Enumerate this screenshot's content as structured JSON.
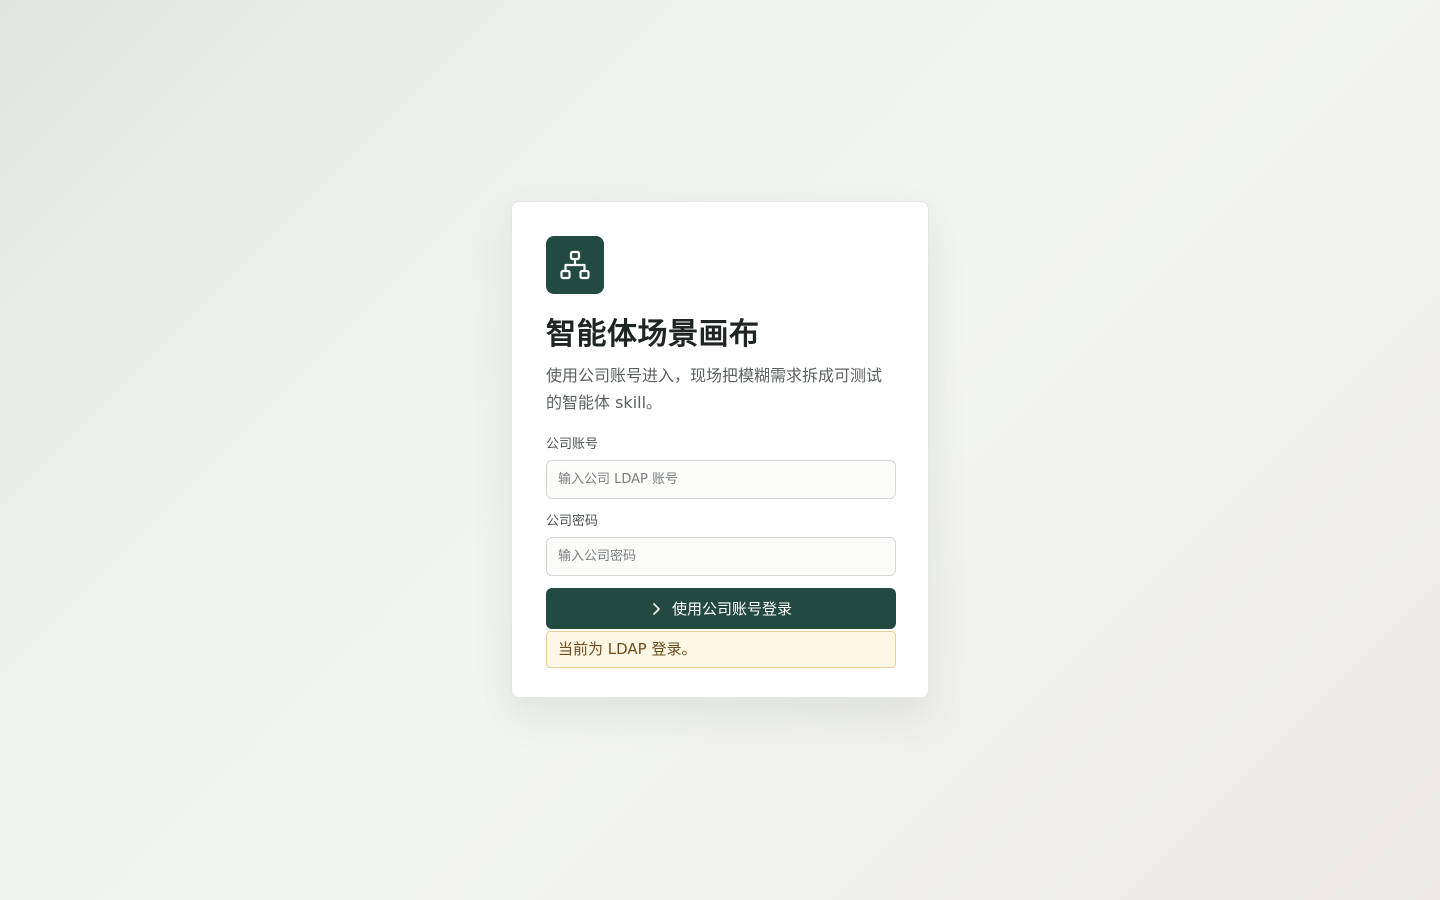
{
  "app": {
    "logo_icon": "sitemap-icon",
    "title": "智能体场景画布",
    "subtitle": "使用公司账号进入，现场把模糊需求拆成可测试的智能体 skill。"
  },
  "form": {
    "account": {
      "label": "公司账号",
      "placeholder": "输入公司 LDAP 账号",
      "value": ""
    },
    "password": {
      "label": "公司密码",
      "placeholder": "输入公司密码",
      "value": ""
    },
    "submit": {
      "icon": "chevron-right-icon",
      "label": "使用公司账号登录"
    }
  },
  "notice": {
    "text": "当前为 LDAP 登录。"
  },
  "colors": {
    "primary": "#234a40",
    "notice_bg": "#fdf6e5",
    "notice_border": "#e8cf9c",
    "notice_text": "#6b4e1a"
  }
}
